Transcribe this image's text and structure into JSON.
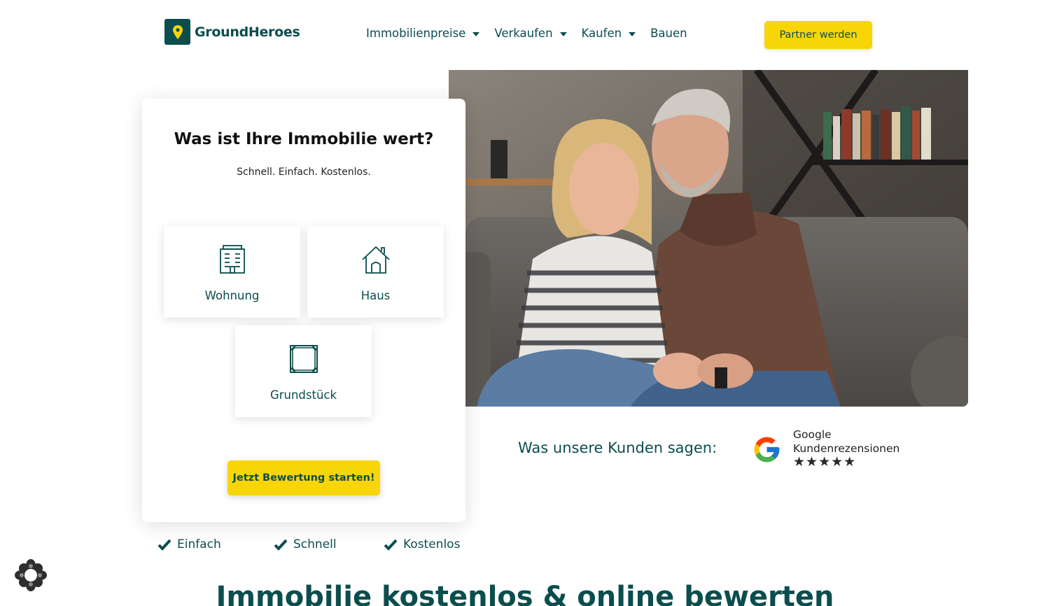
{
  "header": {
    "logo_text": "GroundHeroes",
    "nav": [
      {
        "label": "Immobilienpreise",
        "has_dropdown": true
      },
      {
        "label": "Verkaufen",
        "has_dropdown": true
      },
      {
        "label": "Kaufen",
        "has_dropdown": true
      },
      {
        "label": "Bauen",
        "has_dropdown": false
      }
    ],
    "cta_label": "Partner werden"
  },
  "card": {
    "title": "Was ist Ihre Immobilie wert?",
    "subtitle": "Schnell. Einfach. Kostenlos.",
    "options": [
      {
        "label": "Wohnung",
        "icon": "apartment-building-icon"
      },
      {
        "label": "Haus",
        "icon": "house-icon"
      },
      {
        "label": "Grundstück",
        "icon": "land-plot-icon"
      }
    ],
    "button_label": "Jetzt Bewertung starten!"
  },
  "features": [
    "Einfach",
    "Schnell",
    "Kostenlos"
  ],
  "reviews": {
    "text": "Was unsere Kunden sagen:",
    "provider": "Google",
    "provider_sub": "Kundenrezensionen",
    "stars": "★★★★★",
    "rating": 5
  },
  "headline": "Immobilie kostenlos & online bewerten",
  "colors": {
    "brand_green": "#0c4d4d",
    "accent_yellow": "#f8d507"
  }
}
